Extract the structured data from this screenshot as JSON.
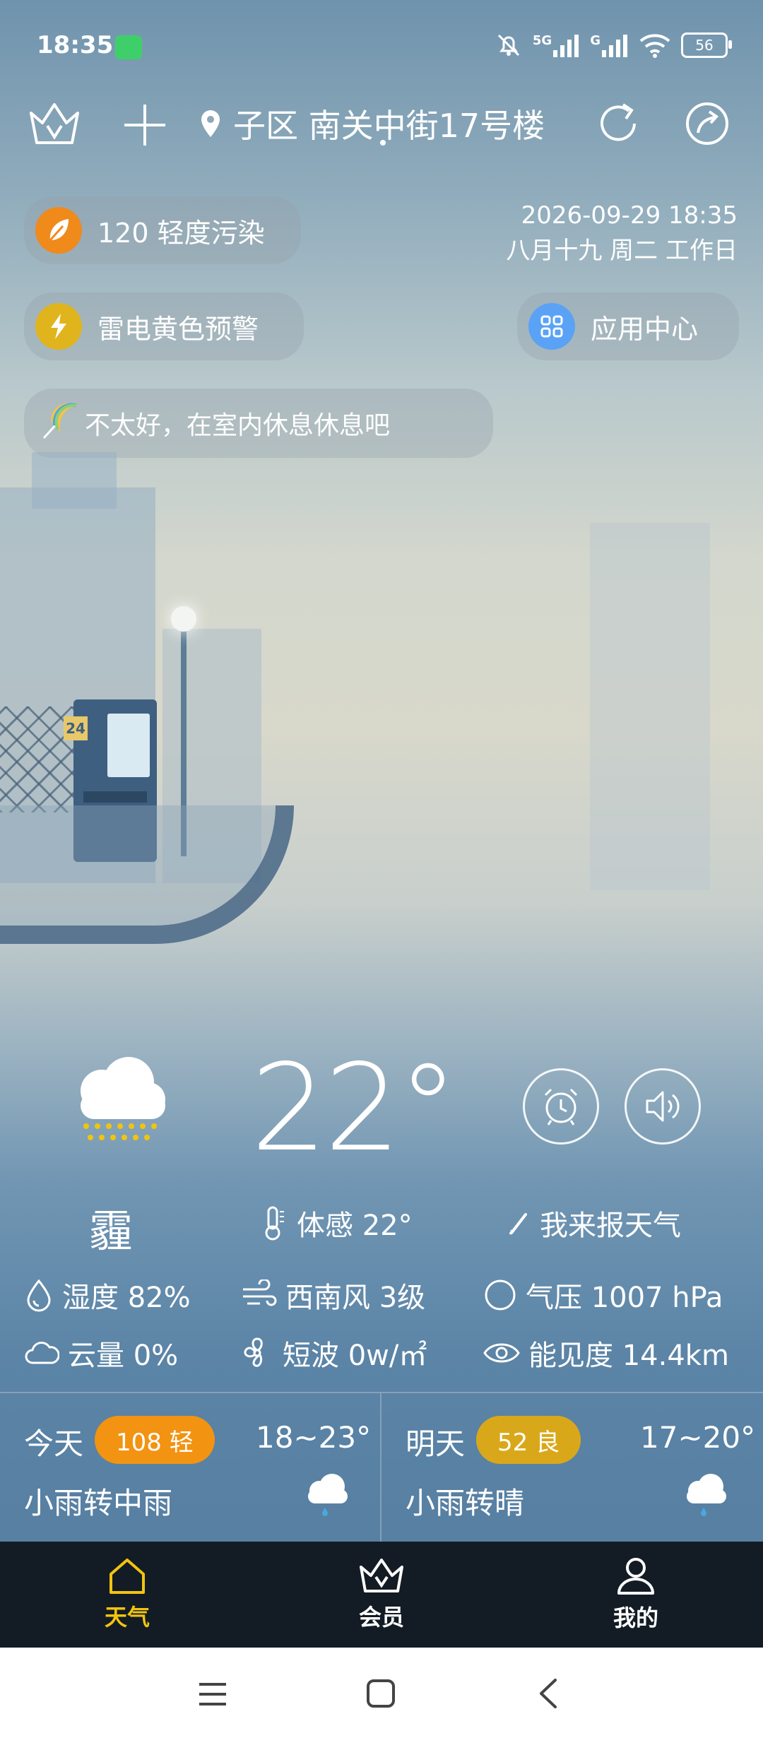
{
  "status": {
    "time": "18:35",
    "battery": "56",
    "signal1_label": "5G",
    "signal2_label": "G"
  },
  "topbar": {
    "location": "子区 南关中街17号楼"
  },
  "air": {
    "label": "120 轻度污染",
    "color": "#f08a1a"
  },
  "date": {
    "datetime": "2026-09-29 18:35",
    "lunar": "八月十九 周二 工作日"
  },
  "alert": {
    "label": "雷电黄色预警",
    "color": "#e0b41c"
  },
  "app_center": {
    "label": "应用中心",
    "color": "#5aa2f5"
  },
  "tip": {
    "label": "不太好，在室内休息休息吧"
  },
  "scene": {
    "shop_sign": "24"
  },
  "current": {
    "temperature": "22°",
    "condition": "霾",
    "feels_like": "体感 22°",
    "report_link": "我来报天气",
    "humidity": "湿度 82%",
    "wind": "西南风 3级",
    "pressure": "气压 1007 hPa",
    "cloud": "云量 0%",
    "shortwave": "短波 0w/㎡",
    "visibility": "能见度 14.4km"
  },
  "forecast": [
    {
      "day": "今天",
      "aqi": "108 轻",
      "aqi_color": "#f39312",
      "range": "18~23°",
      "desc": "小雨转中雨"
    },
    {
      "day": "明天",
      "aqi": "52 良",
      "aqi_color": "#d9a81a",
      "range": "17~20°",
      "desc": "小雨转晴"
    }
  ],
  "tabs": [
    {
      "label": "天气",
      "active": true,
      "color": "#f2c40f"
    },
    {
      "label": "会员",
      "active": false
    },
    {
      "label": "我的",
      "active": false
    }
  ]
}
